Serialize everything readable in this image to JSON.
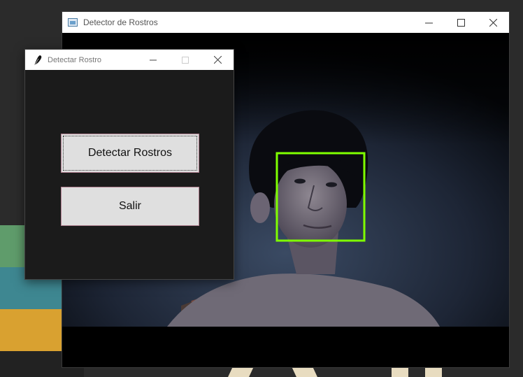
{
  "main_window": {
    "title": "Detector de Rostros",
    "minimize_icon": "minimize-icon",
    "maximize_icon": "maximize-icon",
    "close_icon": "close-icon"
  },
  "dialog": {
    "title": "Detectar Rostro",
    "buttons": {
      "detect_label": "Detectar Rostros",
      "exit_label": "Salir"
    }
  },
  "colors": {
    "face_box": "#7fff00",
    "button_bg": "#dfdfdf",
    "dialog_bg": "#1b1b1b"
  }
}
